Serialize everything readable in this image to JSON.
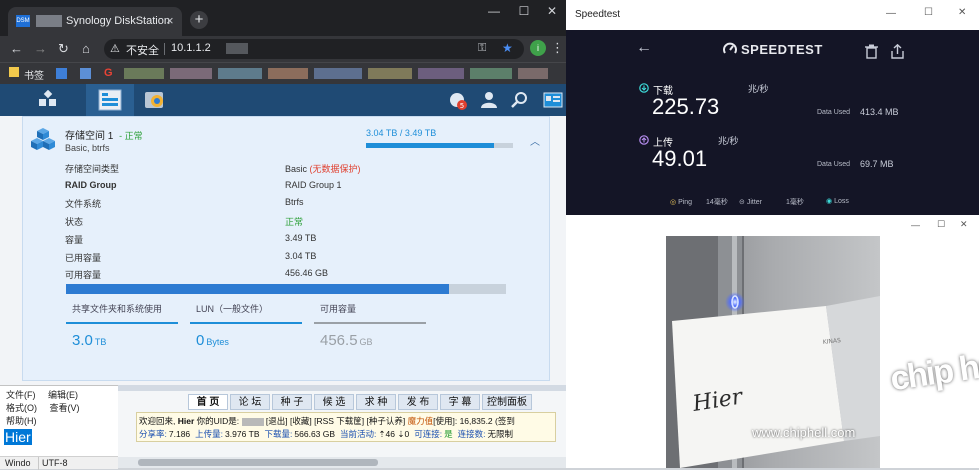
{
  "chrome": {
    "tab_title": "Synology DiskStation",
    "tab_close": "×",
    "new_tab": "+",
    "win_min": "—",
    "win_max": "☐",
    "win_close": "✕",
    "insecure_label": "不安全",
    "url": "10.1.1.2",
    "profile_letter": "i",
    "bookmarks_label": "书签"
  },
  "storage": {
    "pool_title": "存储空间 1",
    "pool_status": "- 正常",
    "pool_subtitle": "Basic, btrfs",
    "usage_text": "3.04 TB / 3.49 TB",
    "usage_fraction": 0.871,
    "rows": [
      {
        "label": "存储空间类型",
        "value": "Basic",
        "extra": "(无数据保护)",
        "bold": false
      },
      {
        "label": "RAID Group",
        "value": "RAID Group 1",
        "extra": "",
        "bold": true
      },
      {
        "label": "文件系统",
        "value": "Btrfs",
        "extra": "",
        "bold": false
      },
      {
        "label": "状态",
        "value": "正常",
        "extra": "",
        "bold": false
      },
      {
        "label": "容量",
        "value": "3.49 TB",
        "extra": "",
        "bold": false
      },
      {
        "label": "已用容量",
        "value": "3.04 TB",
        "extra": "",
        "bold": false
      },
      {
        "label": "可用容量",
        "value": "456.46 GB",
        "extra": "",
        "bold": false
      }
    ],
    "summary": [
      {
        "label": "共享文件夹和系统使用",
        "value": "3.0",
        "unit": "TB"
      },
      {
        "label": "LUN（一般文件）",
        "value": "0",
        "unit": "Bytes"
      },
      {
        "label": "可用容量",
        "value": "456.5",
        "unit": "GB"
      }
    ]
  },
  "notepad": {
    "menu1": [
      "文件(F)",
      "编辑(E)"
    ],
    "menu2": [
      "格式(O)",
      "查看(V)"
    ],
    "menu3": "帮助(H)",
    "selected_text": "Hier",
    "status_window": "Windo",
    "status_encoding": "UTF-8"
  },
  "forum": {
    "tabs": [
      "首 页",
      "论 坛",
      "种 子",
      "候 选",
      "求 种",
      "发 布",
      "字 幕",
      "控制面板"
    ],
    "line1_prefix": "欢迎回来, ",
    "line1_user": "Hier",
    "line1_rest": " 你的UID是:",
    "line1_links": "[退出] [收藏] [RSS 下载筐] [种子认养]",
    "line1_magic": "魔力值",
    "line1_end": "[使用]: 16,835.2 (签到",
    "line2": [
      {
        "label": "分享率:",
        "value": "7.186"
      },
      {
        "label": "上传量:",
        "value": "3.976 TB"
      },
      {
        "label": "下载量:",
        "value": "566.63 GB"
      },
      {
        "label": "当前活动:",
        "value": "⇡46 ⇣0"
      },
      {
        "label": "可连接:",
        "value": "是"
      },
      {
        "label": "连接数:",
        "value": "无限制"
      }
    ]
  },
  "speedtest": {
    "window_title": "Speedtest",
    "logo": "SPEEDTEST",
    "download_label": "下载",
    "download_value": "225.73",
    "download_unit": "兆/秒",
    "download_data_label": "Data Used",
    "download_data_value": "413.4 MB",
    "upload_label": "上传",
    "upload_value": "49.01",
    "upload_unit": "兆/秒",
    "upload_data_label": "Data Used",
    "upload_data_value": "69.7 MB",
    "ping_label": "Ping",
    "ping_value": "14毫秒",
    "jitter_label": "Jitter",
    "jitter_value": "1毫秒",
    "loss_label": "Loss"
  },
  "camera": {
    "note_text": "Hier",
    "watermark": "www.chiphell.com",
    "logo_text": "chip hell",
    "device_text": "KINAS"
  },
  "colors": {
    "dsm_blue": "#1f4a74",
    "accent_blue": "#1e8ed8",
    "speedtest_bg": "#141526",
    "download_icon": "#3ddbd9",
    "upload_icon": "#b58ced"
  }
}
